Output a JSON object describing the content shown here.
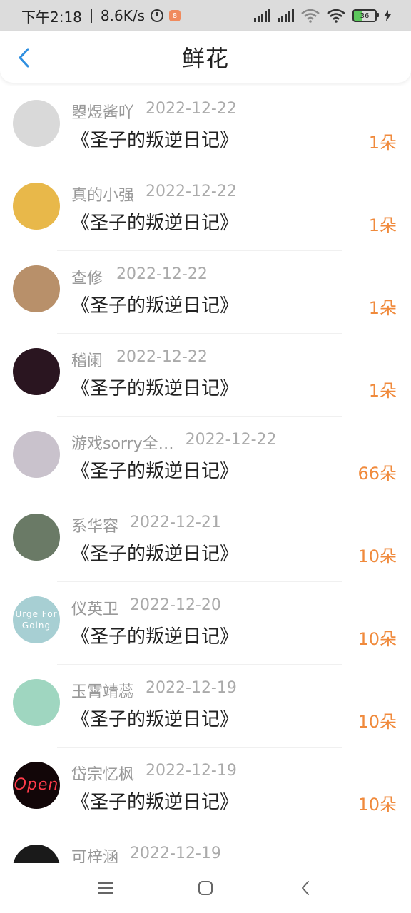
{
  "status_bar": {
    "time": "下午2:18",
    "speed": "8.6K/s",
    "battery": "36",
    "app_badge": "8"
  },
  "header": {
    "title": "鲜花"
  },
  "items": [
    {
      "name": "曌煜酱吖",
      "date": "2022-12-22",
      "book": "《圣子的叛逆日记》",
      "count": "1朵",
      "avatar_color": "#d9d9d9"
    },
    {
      "name": "真的小强",
      "date": "2022-12-22",
      "book": "《圣子的叛逆日记》",
      "count": "1朵",
      "avatar_color": "#e8b84a"
    },
    {
      "name": "查修",
      "date": "2022-12-22",
      "book": "《圣子的叛逆日记》",
      "count": "1朵",
      "avatar_color": "#b8906a"
    },
    {
      "name": "稽阑",
      "date": "2022-12-22",
      "book": "《圣子的叛逆日记》",
      "count": "1朵",
      "avatar_color": "#2a1520"
    },
    {
      "name": "游戏sorry全…",
      "date": "2022-12-22",
      "book": "《圣子的叛逆日记》",
      "count": "66朵",
      "avatar_color": "#c9c2cc"
    },
    {
      "name": "系华容",
      "date": "2022-12-21",
      "book": "《圣子的叛逆日记》",
      "count": "10朵",
      "avatar_color": "#6a7a66"
    },
    {
      "name": "仪英卫",
      "date": "2022-12-20",
      "book": "《圣子的叛逆日记》",
      "count": "10朵",
      "avatar_color": "#a7cfd3",
      "avatar_text": "Urge For Going"
    },
    {
      "name": "玉霄靖蕊",
      "date": "2022-12-19",
      "book": "《圣子的叛逆日记》",
      "count": "10朵",
      "avatar_color": "#9fd6c0"
    },
    {
      "name": "岱宗忆枫",
      "date": "2022-12-19",
      "book": "《圣子的叛逆日记》",
      "count": "10朵",
      "avatar_color": "#120608",
      "avatar_text": "Open"
    },
    {
      "name": "可梓涵",
      "date": "2022-12-19",
      "book": "",
      "count": "",
      "avatar_color": "#1a1a1a"
    }
  ]
}
